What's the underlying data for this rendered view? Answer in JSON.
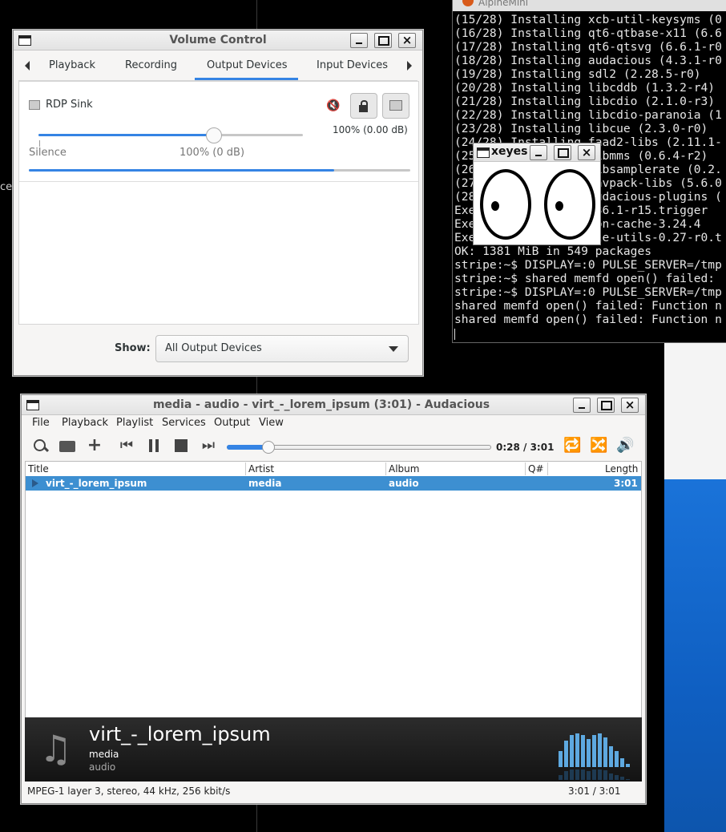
{
  "desktop": {
    "side_text": "ces"
  },
  "terminal": {
    "title": "AlpineMini",
    "lines": [
      "(15/28) Installing xcb-util-keysyms (0",
      "(16/28) Installing qt6-qtbase-x11 (6.6",
      "(17/28) Installing qt6-qtsvg (6.6.1-r0",
      "(18/28) Installing audacious (4.3.1-r0",
      "(19/28) Installing sdl2 (2.28.5-r0)",
      "(20/28) Installing libcddb (1.3.2-r4)",
      "(21/28) Installing libcdio (2.1.0-r3)",
      "(22/28) Installing libcdio-paranoia (1",
      "(23/28) Installing libcue (2.3.0-r0)",
      "(24/28) Installing faad2-libs (2.11.1-",
      "(25/28) Installing libmms (0.6.4-r2)",
      "(26/28) Installing libsamplerate (0.2.",
      "(27/28) Installing wavpack-libs (5.6.0",
      "(28/28) Installing audacious-plugins (",
      "Executing busybox-1.36.1-r15.trigger",
      "Executing gtk+3.0-icon-cache-3.24.4",
      "Executing desktop-file-utils-0.27-r0.t",
      "OK: 1381 MiB in 549 packages",
      "stripe:~$ DISPLAY=:0 PULSE_SERVER=/tmp",
      "stripe:~$ shared memfd open() failed:",
      "stripe:~$ DISPLAY=:0 PULSE_SERVER=/tmp",
      "shared memfd open() failed: Function n",
      "shared memfd open() failed: Function n"
    ]
  },
  "volume_control": {
    "title": "Volume Control",
    "tabs": [
      "Playback",
      "Recording",
      "Output Devices",
      "Input Devices"
    ],
    "active_tab": "Output Devices",
    "device_name": "RDP Sink",
    "volume_readout": "100% (0.00 dB)",
    "slider_label_left": "Silence",
    "slider_label_mid": "100% (0 dB)",
    "volume_level": 0.66,
    "peak_level": 0.8,
    "show_label": "Show:",
    "show_value": "All Output Devices"
  },
  "xeyes": {
    "title": "xeyes"
  },
  "audacious": {
    "title": "media - audio - virt_-_lorem_ipsum (3:01) - Audacious",
    "menu": [
      "File",
      "Playback",
      "Playlist",
      "Services",
      "Output",
      "View"
    ],
    "time_display": "0:28 / 3:01",
    "seek_fraction": 0.155,
    "columns": [
      "Title",
      "Artist",
      "Album",
      "Q#",
      "Length"
    ],
    "rows": [
      {
        "title": "virt_-_lorem_ipsum",
        "artist": "media",
        "album": "audio",
        "queue": "",
        "length": "3:01"
      }
    ],
    "now_playing": {
      "title": "virt_-_lorem_ipsum",
      "artist": "media",
      "album": "audio"
    },
    "status_left": "MPEG-1 layer 3, stereo, 44 kHz, 256 kbit/s",
    "status_right": "3:01 / 3:01",
    "visualizer_levels": [
      0.45,
      0.75,
      0.9,
      0.95,
      0.9,
      0.8,
      0.9,
      0.95,
      0.85,
      0.6,
      0.45,
      0.25,
      0.1
    ]
  },
  "colors": {
    "accent": "#3584e4",
    "selection": "#3d8fd1",
    "terminal_bg": "#000000"
  }
}
